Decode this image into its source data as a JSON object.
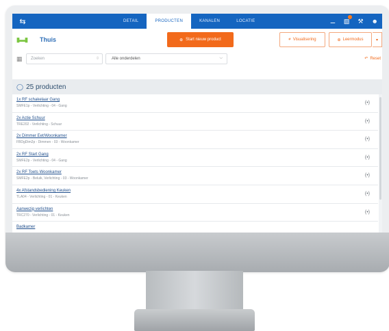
{
  "topbar": {
    "tabs": [
      {
        "label": "DETAIL"
      },
      {
        "label": "PRODUCTEN",
        "active": true
      },
      {
        "label": "KANALEN"
      },
      {
        "label": "LOCATIE"
      }
    ],
    "icons": [
      "back-arrow-icon",
      "wifi-icon",
      "notification-icon",
      "wrench-icon",
      "user-icon"
    ],
    "accent_color": "#1565c0"
  },
  "header": {
    "title": "Thuis",
    "start_button": "Start nieuw product",
    "visualisation_button": "Visualisering",
    "leer_button": "Leermodus",
    "primary_color": "#f26a1b"
  },
  "filters": {
    "search_placeholder": "Zoeken",
    "select_value": "Alle onderdelen",
    "reset_label": "Reset"
  },
  "products": {
    "count_label": "25 producten",
    "items": [
      {
        "name": "1x RF schakelaar Gang",
        "meta": "SMFE1p - Verlichting - 04 - Gang"
      },
      {
        "name": "2x Actie Schuur",
        "meta": "TRE202 - Verlichting - Schuur"
      },
      {
        "name": "2x Dimmer Eet/Woonkamer",
        "meta": "FBDgDim2p - Dimmen - 03 - Woonkamer"
      },
      {
        "name": "2x RF Start Gang",
        "meta": "SMFE2p - Verlichting - 04 - Gang"
      },
      {
        "name": "2x RF Toets Woonkamer",
        "meta": "SMFE2p - Beluik, Verlichting - 03 - Woonkamer"
      },
      {
        "name": "4x Afstandsbediening Keuken",
        "meta": "TLA04 - Verlichting - 01 - Keuken"
      },
      {
        "name": "Aanwezig verlichten",
        "meta": "TRC270 - Verlichting - 01 - Keuken"
      },
      {
        "name": "Badkamer",
        "meta": ""
      }
    ]
  }
}
